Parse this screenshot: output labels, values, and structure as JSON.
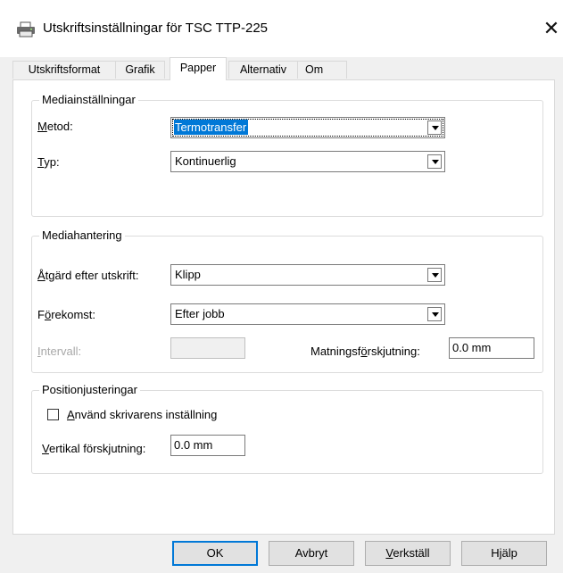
{
  "window": {
    "title": "Utskriftsinställningar för TSC TTP-225",
    "close_glyph": "✕",
    "icon": "printer-icon"
  },
  "tabs": [
    {
      "label": "Utskriftsformat",
      "active": false
    },
    {
      "label": "Grafik",
      "active": false
    },
    {
      "label": "Papper",
      "active": true
    },
    {
      "label": "Alternativ",
      "active": false
    },
    {
      "label": "Om",
      "active": false
    }
  ],
  "media_settings": {
    "title": "Mediainställningar",
    "method": {
      "label_underlined": "M",
      "label_rest": "etod:",
      "value": "Termotransfer"
    },
    "type": {
      "label_underlined": "T",
      "label_rest": "yp:",
      "value": "Kontinuerlig"
    }
  },
  "media_handling": {
    "title": "Mediahantering",
    "action": {
      "label_underlined": "Å",
      "label_rest": "tgärd efter utskrift:",
      "value": "Klipp"
    },
    "occurrence": {
      "label_pre": "F",
      "label_underlined": "ö",
      "label_rest": "rekomst:",
      "value": "Efter jobb"
    },
    "interval": {
      "label_underlined": "I",
      "label_rest": "ntervall:",
      "value": ""
    },
    "feed_offset": {
      "label_pre": "Matningsf",
      "label_underlined": "ö",
      "label_rest": "rskjutning:",
      "value": "0.0 mm"
    }
  },
  "position_adjust": {
    "title": "Positionjusteringar",
    "use_printer_setting": {
      "checked": false,
      "label_underlined": "A",
      "label_rest": "nvänd skrivarens inställning"
    },
    "vertical_offset": {
      "label_underlined": "V",
      "label_rest": "ertikal förskjutning:",
      "value": "0.0 mm"
    }
  },
  "buttons": {
    "ok": "OK",
    "cancel": "Avbryt",
    "apply_underlined": "V",
    "apply_rest": "erkställ",
    "help": "Hjälp"
  }
}
